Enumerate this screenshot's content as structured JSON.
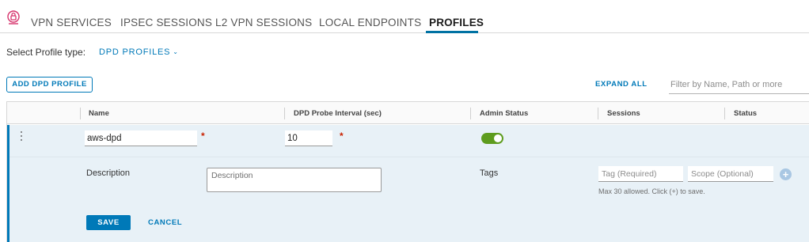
{
  "tabs": [
    {
      "label": "VPN SERVICES"
    },
    {
      "label": "IPSEC SESSIONS"
    },
    {
      "label": "L2 VPN SESSIONS"
    },
    {
      "label": "LOCAL ENDPOINTS"
    },
    {
      "label": "PROFILES",
      "active": true
    }
  ],
  "profile_type": {
    "label": "Select Profile type:",
    "value": "DPD PROFILES"
  },
  "actions": {
    "add_label": "ADD DPD PROFILE",
    "expand_all_label": "EXPAND ALL",
    "filter_placeholder": "Filter by Name, Path or more"
  },
  "grid": {
    "columns": [
      "Name",
      "DPD Probe Interval (sec)",
      "Admin Status",
      "Sessions",
      "Status"
    ]
  },
  "edit_row": {
    "name_value": "aws-dpd",
    "interval_value": "10",
    "required_mark": "*",
    "admin_status_enabled": true,
    "description_label": "Description",
    "description_placeholder": "Description",
    "tags_label": "Tags",
    "tag_placeholder": "Tag (Required)",
    "scope_placeholder": "Scope (Optional)",
    "tag_hint": "Max 30 allowed. Click (+) to save.",
    "plus_symbol": "+",
    "save_label": "SAVE",
    "cancel_label": "CANCEL"
  },
  "colors": {
    "accent": "#0079b8",
    "toggle_on": "#5e9c1e",
    "required": "#c92100",
    "row_highlight": "#e8f1f7"
  },
  "icons": {
    "tab_icon": "lock-shield-icon",
    "chevron": "chevron-down-icon",
    "row_menu": "vertical-ellipsis-icon",
    "add": "plus-circle-icon"
  }
}
